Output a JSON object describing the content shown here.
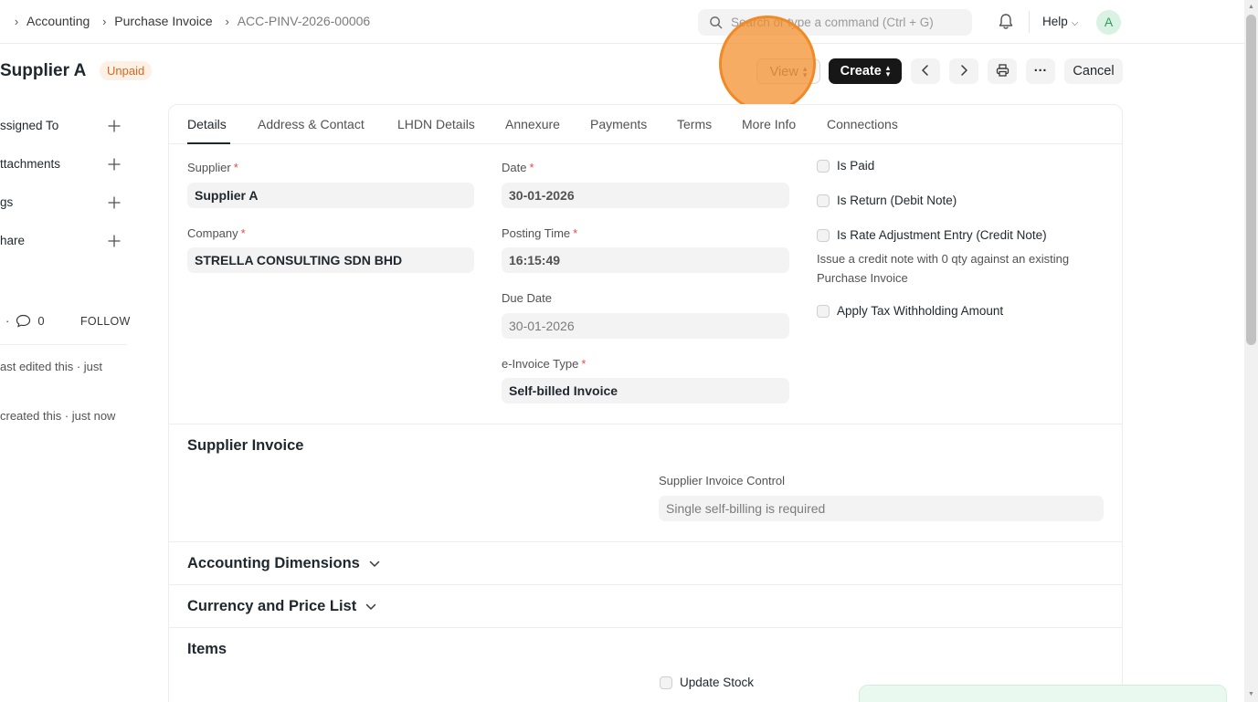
{
  "navbar": {
    "breadcrumbs": [
      "Accounting",
      "Purchase Invoice",
      "ACC-PINV-2026-00006"
    ],
    "search_placeholder": "Search or type a command (Ctrl + G)",
    "help_label": "Help",
    "avatar_initial": "A"
  },
  "page": {
    "title": "Supplier A",
    "status": "Unpaid",
    "buttons": {
      "view": "View",
      "create": "Create",
      "more": "···",
      "cancel": "Cancel"
    }
  },
  "sidebar": {
    "items": [
      "ssigned To",
      "ttachments",
      "gs",
      "hare"
    ],
    "comment_count": "0",
    "follow_label": "FOLLOW",
    "activity": [
      "ast edited this · just",
      "created this · just now"
    ]
  },
  "tabs": [
    "Details",
    "Address & Contact",
    "LHDN Details",
    "Annexure",
    "Payments",
    "Terms",
    "More Info",
    "Connections"
  ],
  "details": {
    "supplier_label": "Supplier",
    "supplier_value": "Supplier A",
    "company_label": "Company",
    "company_value": "STRELLA CONSULTING SDN BHD",
    "date_label": "Date",
    "date_value": "30-01-2026",
    "posting_time_label": "Posting Time",
    "posting_time_value": "16:15:49",
    "due_date_label": "Due Date",
    "due_date_value": "30-01-2026",
    "einvoice_type_label": "e-Invoice Type",
    "einvoice_type_value": "Self-billed Invoice",
    "required_mark": "*",
    "checkboxes": {
      "is_paid": "Is Paid",
      "is_return": "Is Return (Debit Note)",
      "is_rate_adjustment": "Is Rate Adjustment Entry (Credit Note)",
      "rate_adjustment_desc": "Issue a credit note with 0 qty against an existing Purchase Invoice",
      "apply_tax_withholding": "Apply Tax Withholding Amount"
    }
  },
  "sections": {
    "supplier_invoice": "Supplier Invoice",
    "supplier_invoice_control_label": "Supplier Invoice Control",
    "supplier_invoice_control_value": "Single self-billing is required",
    "accounting_dimensions": "Accounting Dimensions",
    "currency_price_list": "Currency and Price List",
    "items": "Items",
    "update_stock": "Update Stock"
  }
}
